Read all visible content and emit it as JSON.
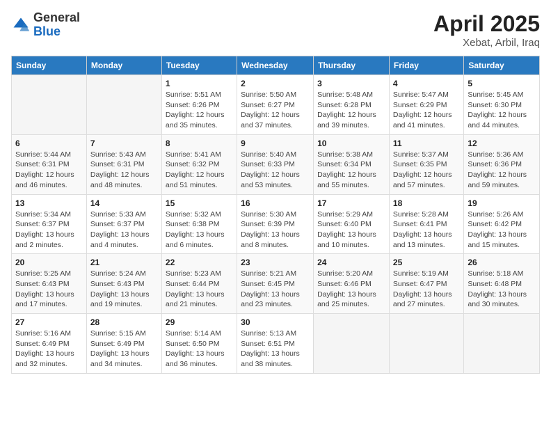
{
  "header": {
    "logo_general": "General",
    "logo_blue": "Blue",
    "title": "April 2025",
    "subtitle": "Xebat, Arbil, Iraq"
  },
  "days_of_week": [
    "Sunday",
    "Monday",
    "Tuesday",
    "Wednesday",
    "Thursday",
    "Friday",
    "Saturday"
  ],
  "weeks": [
    [
      {
        "day": "",
        "info": ""
      },
      {
        "day": "",
        "info": ""
      },
      {
        "day": "1",
        "info": "Sunrise: 5:51 AM\nSunset: 6:26 PM\nDaylight: 12 hours and 35 minutes."
      },
      {
        "day": "2",
        "info": "Sunrise: 5:50 AM\nSunset: 6:27 PM\nDaylight: 12 hours and 37 minutes."
      },
      {
        "day": "3",
        "info": "Sunrise: 5:48 AM\nSunset: 6:28 PM\nDaylight: 12 hours and 39 minutes."
      },
      {
        "day": "4",
        "info": "Sunrise: 5:47 AM\nSunset: 6:29 PM\nDaylight: 12 hours and 41 minutes."
      },
      {
        "day": "5",
        "info": "Sunrise: 5:45 AM\nSunset: 6:30 PM\nDaylight: 12 hours and 44 minutes."
      }
    ],
    [
      {
        "day": "6",
        "info": "Sunrise: 5:44 AM\nSunset: 6:31 PM\nDaylight: 12 hours and 46 minutes."
      },
      {
        "day": "7",
        "info": "Sunrise: 5:43 AM\nSunset: 6:31 PM\nDaylight: 12 hours and 48 minutes."
      },
      {
        "day": "8",
        "info": "Sunrise: 5:41 AM\nSunset: 6:32 PM\nDaylight: 12 hours and 51 minutes."
      },
      {
        "day": "9",
        "info": "Sunrise: 5:40 AM\nSunset: 6:33 PM\nDaylight: 12 hours and 53 minutes."
      },
      {
        "day": "10",
        "info": "Sunrise: 5:38 AM\nSunset: 6:34 PM\nDaylight: 12 hours and 55 minutes."
      },
      {
        "day": "11",
        "info": "Sunrise: 5:37 AM\nSunset: 6:35 PM\nDaylight: 12 hours and 57 minutes."
      },
      {
        "day": "12",
        "info": "Sunrise: 5:36 AM\nSunset: 6:36 PM\nDaylight: 12 hours and 59 minutes."
      }
    ],
    [
      {
        "day": "13",
        "info": "Sunrise: 5:34 AM\nSunset: 6:37 PM\nDaylight: 13 hours and 2 minutes."
      },
      {
        "day": "14",
        "info": "Sunrise: 5:33 AM\nSunset: 6:37 PM\nDaylight: 13 hours and 4 minutes."
      },
      {
        "day": "15",
        "info": "Sunrise: 5:32 AM\nSunset: 6:38 PM\nDaylight: 13 hours and 6 minutes."
      },
      {
        "day": "16",
        "info": "Sunrise: 5:30 AM\nSunset: 6:39 PM\nDaylight: 13 hours and 8 minutes."
      },
      {
        "day": "17",
        "info": "Sunrise: 5:29 AM\nSunset: 6:40 PM\nDaylight: 13 hours and 10 minutes."
      },
      {
        "day": "18",
        "info": "Sunrise: 5:28 AM\nSunset: 6:41 PM\nDaylight: 13 hours and 13 minutes."
      },
      {
        "day": "19",
        "info": "Sunrise: 5:26 AM\nSunset: 6:42 PM\nDaylight: 13 hours and 15 minutes."
      }
    ],
    [
      {
        "day": "20",
        "info": "Sunrise: 5:25 AM\nSunset: 6:43 PM\nDaylight: 13 hours and 17 minutes."
      },
      {
        "day": "21",
        "info": "Sunrise: 5:24 AM\nSunset: 6:43 PM\nDaylight: 13 hours and 19 minutes."
      },
      {
        "day": "22",
        "info": "Sunrise: 5:23 AM\nSunset: 6:44 PM\nDaylight: 13 hours and 21 minutes."
      },
      {
        "day": "23",
        "info": "Sunrise: 5:21 AM\nSunset: 6:45 PM\nDaylight: 13 hours and 23 minutes."
      },
      {
        "day": "24",
        "info": "Sunrise: 5:20 AM\nSunset: 6:46 PM\nDaylight: 13 hours and 25 minutes."
      },
      {
        "day": "25",
        "info": "Sunrise: 5:19 AM\nSunset: 6:47 PM\nDaylight: 13 hours and 27 minutes."
      },
      {
        "day": "26",
        "info": "Sunrise: 5:18 AM\nSunset: 6:48 PM\nDaylight: 13 hours and 30 minutes."
      }
    ],
    [
      {
        "day": "27",
        "info": "Sunrise: 5:16 AM\nSunset: 6:49 PM\nDaylight: 13 hours and 32 minutes."
      },
      {
        "day": "28",
        "info": "Sunrise: 5:15 AM\nSunset: 6:49 PM\nDaylight: 13 hours and 34 minutes."
      },
      {
        "day": "29",
        "info": "Sunrise: 5:14 AM\nSunset: 6:50 PM\nDaylight: 13 hours and 36 minutes."
      },
      {
        "day": "30",
        "info": "Sunrise: 5:13 AM\nSunset: 6:51 PM\nDaylight: 13 hours and 38 minutes."
      },
      {
        "day": "",
        "info": ""
      },
      {
        "day": "",
        "info": ""
      },
      {
        "day": "",
        "info": ""
      }
    ]
  ]
}
